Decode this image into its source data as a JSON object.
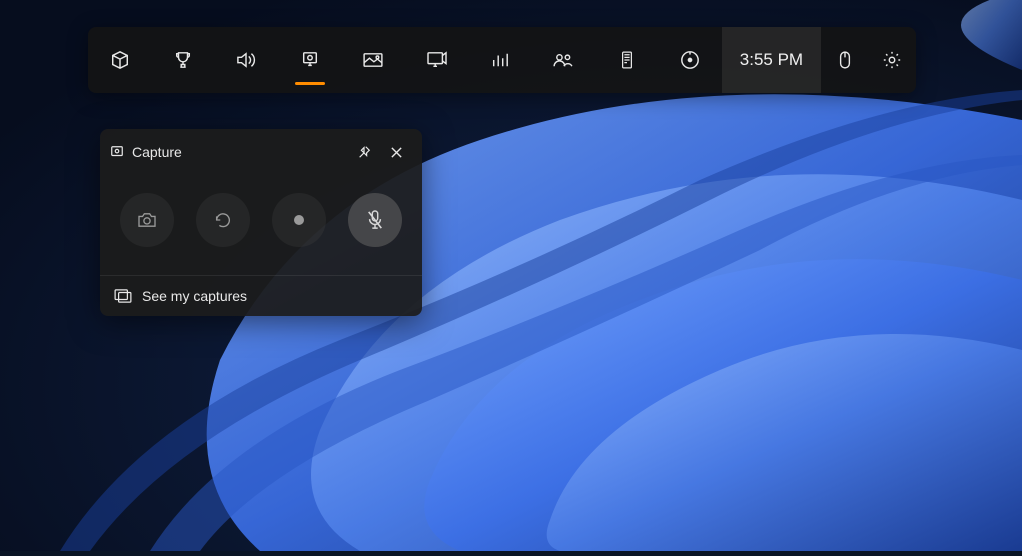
{
  "gamebar": {
    "items": [
      {
        "name": "widget-menu",
        "icon": "widget"
      },
      {
        "name": "achievements",
        "icon": "trophy"
      },
      {
        "name": "audio",
        "icon": "volume"
      },
      {
        "name": "capture",
        "icon": "capture",
        "active": true
      },
      {
        "name": "gallery",
        "icon": "gallery"
      },
      {
        "name": "broadcast",
        "icon": "broadcast"
      },
      {
        "name": "performance",
        "icon": "performance"
      },
      {
        "name": "xbox-social",
        "icon": "social"
      },
      {
        "name": "resources",
        "icon": "resources"
      },
      {
        "name": "spotify",
        "icon": "spotify"
      }
    ],
    "time": "3:55 PM",
    "right_items": [
      {
        "name": "mouse-settings",
        "icon": "mouse"
      },
      {
        "name": "settings",
        "icon": "gear"
      }
    ]
  },
  "capture_widget": {
    "title": "Capture",
    "buttons": {
      "screenshot": "screenshot",
      "record_last": "record-last",
      "record": "record",
      "mic_off": "mic-off"
    },
    "footer_label": "See my captures"
  }
}
